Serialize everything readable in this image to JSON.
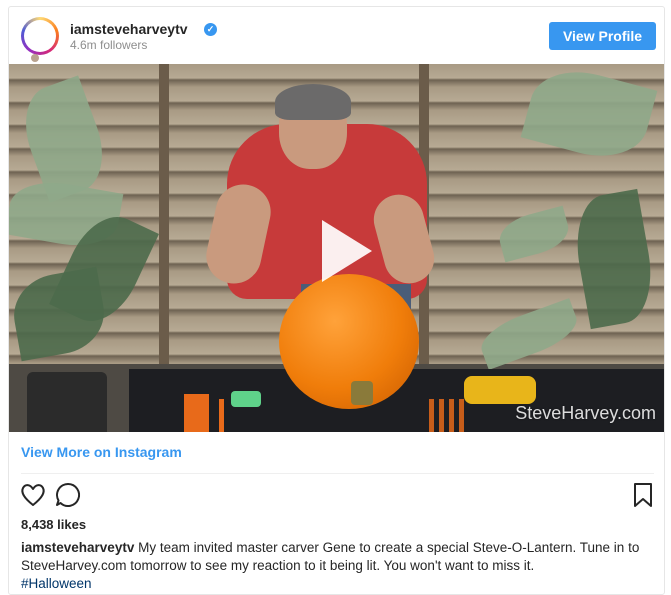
{
  "header": {
    "username": "iamsteveharveytv",
    "followers": "4.6m followers",
    "verified_icon": "verified-badge-icon",
    "view_profile_label": "View Profile"
  },
  "media": {
    "watermark": "SteveHarvey.com",
    "play_icon": "play-icon"
  },
  "footer": {
    "view_more_label": "View More on Instagram",
    "likes": "8,438 likes",
    "caption_user": "iamsteveharveytv",
    "caption_text": "My team invited master carver Gene to create a special Steve-O-Lantern. Tune in to SteveHarvey.com tomorrow to see my reaction to it being lit. You won't want to miss it.",
    "hashtag": "#Halloween"
  },
  "colors": {
    "accent": "#3897f0",
    "text": "#262626",
    "muted": "#8e8e8e"
  }
}
